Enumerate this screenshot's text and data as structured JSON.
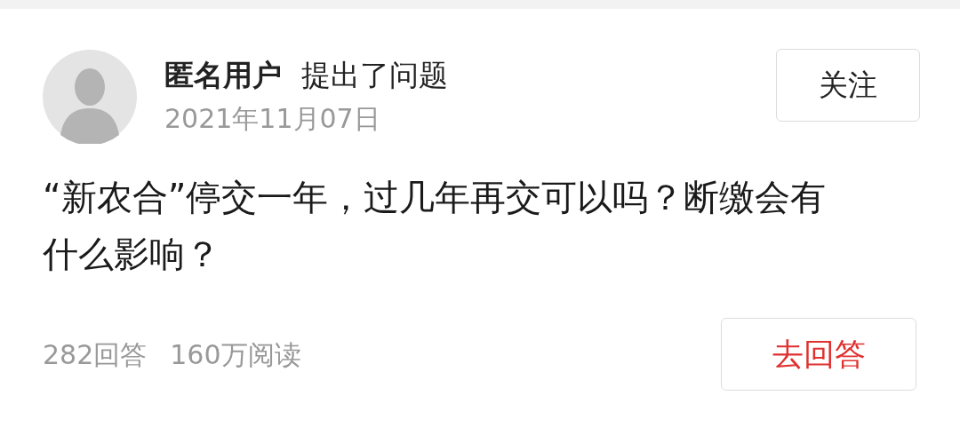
{
  "question_card": {
    "author": {
      "name": "匿名用户",
      "action": "提出了问题",
      "date": "2021年11月07日"
    },
    "follow_button": "关注",
    "question": "“新农合”停交一年，过几年再交可以吗？断缴会有什么影响？",
    "stats": [
      "282回答",
      "160万阅读"
    ],
    "answer_button": "去回答"
  }
}
